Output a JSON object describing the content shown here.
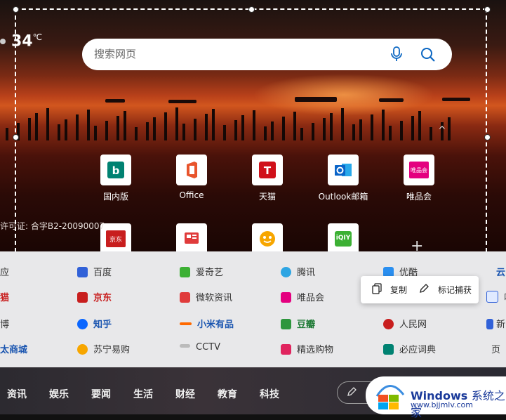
{
  "weather": {
    "temp": "34",
    "unit": "℃"
  },
  "search": {
    "placeholder": "搜索网页"
  },
  "tiles": [
    {
      "label": "国内版",
      "icon": "bing-icon"
    },
    {
      "label": "Office",
      "icon": "office-icon"
    },
    {
      "label": "天猫",
      "icon": "tmall-icon"
    },
    {
      "label": "Outlook邮箱",
      "icon": "outlook-icon"
    },
    {
      "label": "唯品会",
      "icon": "vip-icon",
      "icon_text": "唯品会"
    },
    {
      "label": "",
      "icon": "jd-icon",
      "icon_text": "京东"
    },
    {
      "label": "",
      "icon": "news-icon"
    },
    {
      "label": "",
      "icon": "suning-icon"
    },
    {
      "label": "",
      "icon": "iqiyi-icon",
      "icon_text": "iQIY"
    }
  ],
  "license": "许可证: 合字B2-20090007",
  "links": {
    "row1": [
      "应",
      "百度",
      "爱奇艺",
      "腾讯",
      "优酷",
      "云"
    ],
    "row2": [
      "猫",
      "京东",
      "微软资讯",
      "唯品会",
      "叫"
    ],
    "row3": [
      "博",
      "知乎",
      "小米有品",
      "豆瓣",
      "人民网",
      "新"
    ],
    "row4": [
      "太商城",
      "苏宁易购",
      "CCTV",
      "精选购物",
      "必应词典",
      "页"
    ]
  },
  "popup": {
    "copy": "复制",
    "mark": "标记捕获"
  },
  "nav": [
    "资讯",
    "娱乐",
    "要闻",
    "生活",
    "财经",
    "教育",
    "科技"
  ],
  "watermark": {
    "brand": "Windows",
    "suffix": "系统之家",
    "url": "www.bjjmlv.com"
  },
  "colors": {
    "accent": "#0078d4",
    "jd_red": "#c81e1e",
    "tmall_red": "#d0101a",
    "iqiyi_green": "#3cb034"
  }
}
